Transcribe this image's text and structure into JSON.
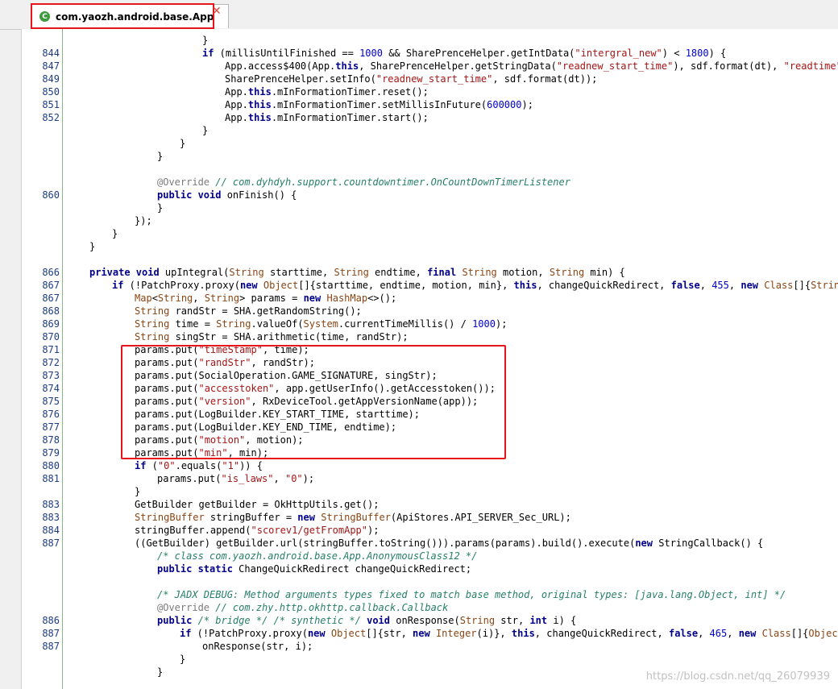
{
  "tab": {
    "title": "com.yaozh.android.base.App",
    "icon": "class-icon-c",
    "close_icon": "close-icon"
  },
  "lines": [
    {
      "n": "",
      "i": 6,
      "s": [
        [
          "p",
          "}"
        ]
      ]
    },
    {
      "n": "844",
      "i": 6,
      "s": [
        [
          "k",
          "if"
        ],
        [
          "p",
          " (millisUntilFinished == "
        ],
        [
          "n",
          "1000"
        ],
        [
          "p",
          " && SharePrenceHelper.getIntData("
        ],
        [
          "s",
          "\"intergral_new\""
        ],
        [
          "p",
          ") < "
        ],
        [
          "n",
          "1800"
        ],
        [
          "p",
          ") {"
        ]
      ]
    },
    {
      "n": "847",
      "i": 7,
      "s": [
        [
          "p",
          "App.access$400(App."
        ],
        [
          "k",
          "this"
        ],
        [
          "p",
          ", SharePrenceHelper.getStringData("
        ],
        [
          "s",
          "\"readnew_start_time\""
        ],
        [
          "p",
          "), sdf.format(dt), "
        ],
        [
          "s",
          "\"readtime\""
        ],
        [
          "p",
          ", \""
        ]
      ]
    },
    {
      "n": "849",
      "i": 7,
      "s": [
        [
          "p",
          "SharePrenceHelper.setInfo("
        ],
        [
          "s",
          "\"readnew_start_time\""
        ],
        [
          "p",
          ", sdf.format(dt));"
        ]
      ]
    },
    {
      "n": "850",
      "i": 7,
      "s": [
        [
          "p",
          "App."
        ],
        [
          "k",
          "this"
        ],
        [
          "p",
          ".mInFormationTimer.reset();"
        ]
      ]
    },
    {
      "n": "851",
      "i": 7,
      "s": [
        [
          "p",
          "App."
        ],
        [
          "k",
          "this"
        ],
        [
          "p",
          ".mInFormationTimer.setMillisInFuture("
        ],
        [
          "n",
          "600000"
        ],
        [
          "p",
          ");"
        ]
      ]
    },
    {
      "n": "852",
      "i": 7,
      "s": [
        [
          "p",
          "App."
        ],
        [
          "k",
          "this"
        ],
        [
          "p",
          ".mInFormationTimer.start();"
        ]
      ]
    },
    {
      "n": "",
      "i": 6,
      "s": [
        [
          "p",
          "}"
        ]
      ]
    },
    {
      "n": "",
      "i": 5,
      "s": [
        [
          "p",
          "}"
        ]
      ]
    },
    {
      "n": "",
      "i": 4,
      "s": [
        [
          "p",
          "}"
        ]
      ]
    },
    {
      "n": "",
      "i": 0,
      "s": []
    },
    {
      "n": "",
      "i": 4,
      "s": [
        [
          "a",
          "@Override"
        ],
        [
          "c",
          " // com.dyhdyh.support.countdowntimer.OnCountDownTimerListener"
        ]
      ]
    },
    {
      "n": "860",
      "i": 4,
      "s": [
        [
          "k",
          "public void"
        ],
        [
          "p",
          " onFinish() {"
        ]
      ]
    },
    {
      "n": "",
      "i": 4,
      "s": [
        [
          "p",
          "}"
        ]
      ]
    },
    {
      "n": "",
      "i": 3,
      "s": [
        [
          "p",
          "});"
        ]
      ]
    },
    {
      "n": "",
      "i": 2,
      "s": [
        [
          "p",
          "}"
        ]
      ]
    },
    {
      "n": "",
      "i": 1,
      "s": [
        [
          "p",
          "}"
        ]
      ]
    },
    {
      "n": "",
      "i": 0,
      "s": []
    },
    {
      "n": "866",
      "i": 1,
      "s": [
        [
          "k",
          "private void"
        ],
        [
          "p",
          " upIntegral("
        ],
        [
          "t",
          "String"
        ],
        [
          "p",
          " starttime, "
        ],
        [
          "t",
          "String"
        ],
        [
          "p",
          " endtime, "
        ],
        [
          "k",
          "final"
        ],
        [
          "p",
          " "
        ],
        [
          "t",
          "String"
        ],
        [
          "p",
          " motion, "
        ],
        [
          "t",
          "String"
        ],
        [
          "p",
          " min) {"
        ]
      ]
    },
    {
      "n": "867",
      "i": 2,
      "s": [
        [
          "k",
          "if"
        ],
        [
          "p",
          " (!PatchProxy.proxy("
        ],
        [
          "k",
          "new"
        ],
        [
          "p",
          " "
        ],
        [
          "t",
          "Object"
        ],
        [
          "p",
          "[]{starttime, endtime, motion, min}, "
        ],
        [
          "k",
          "this"
        ],
        [
          "p",
          ", changeQuickRedirect, "
        ],
        [
          "k",
          "false"
        ],
        [
          "p",
          ", "
        ],
        [
          "n",
          "455"
        ],
        [
          "p",
          ", "
        ],
        [
          "k",
          "new"
        ],
        [
          "p",
          " "
        ],
        [
          "t",
          "Class"
        ],
        [
          "p",
          "[]{"
        ],
        [
          "t",
          "String"
        ],
        [
          "p",
          ".cl"
        ]
      ]
    },
    {
      "n": "867",
      "i": 3,
      "s": [
        [
          "t",
          "Map"
        ],
        [
          "p",
          "<"
        ],
        [
          "t",
          "String"
        ],
        [
          "p",
          ", "
        ],
        [
          "t",
          "String"
        ],
        [
          "p",
          "> params = "
        ],
        [
          "k",
          "new"
        ],
        [
          "p",
          " "
        ],
        [
          "t",
          "HashMap"
        ],
        [
          "p",
          "<>();"
        ]
      ]
    },
    {
      "n": "868",
      "i": 3,
      "s": [
        [
          "t",
          "String"
        ],
        [
          "p",
          " randStr = SHA.getRandomString();"
        ]
      ]
    },
    {
      "n": "869",
      "i": 3,
      "s": [
        [
          "t",
          "String"
        ],
        [
          "p",
          " time = "
        ],
        [
          "t",
          "String"
        ],
        [
          "p",
          ".valueOf("
        ],
        [
          "t",
          "System"
        ],
        [
          "p",
          ".currentTimeMillis() / "
        ],
        [
          "n",
          "1000"
        ],
        [
          "p",
          ");"
        ]
      ]
    },
    {
      "n": "870",
      "i": 3,
      "s": [
        [
          "t",
          "String"
        ],
        [
          "p",
          " singStr = SHA.arithmetic(time, randStr);"
        ]
      ]
    },
    {
      "n": "871",
      "i": 3,
      "s": [
        [
          "p",
          "params.put("
        ],
        [
          "s",
          "\"timeStamp\""
        ],
        [
          "p",
          ", time);"
        ]
      ]
    },
    {
      "n": "872",
      "i": 3,
      "s": [
        [
          "p",
          "params.put("
        ],
        [
          "s",
          "\"randStr\""
        ],
        [
          "p",
          ", randStr);"
        ]
      ]
    },
    {
      "n": "873",
      "i": 3,
      "s": [
        [
          "p",
          "params.put(SocialOperation.GAME_SIGNATURE, singStr);"
        ]
      ]
    },
    {
      "n": "874",
      "i": 3,
      "s": [
        [
          "p",
          "params.put("
        ],
        [
          "s",
          "\"accesstoken\""
        ],
        [
          "p",
          ", app.getUserInfo().getAccesstoken());"
        ]
      ]
    },
    {
      "n": "875",
      "i": 3,
      "s": [
        [
          "p",
          "params.put("
        ],
        [
          "s",
          "\"version\""
        ],
        [
          "p",
          ", RxDeviceTool.getAppVersionName(app));"
        ]
      ]
    },
    {
      "n": "876",
      "i": 3,
      "s": [
        [
          "p",
          "params.put(LogBuilder.KEY_START_TIME, starttime);"
        ]
      ]
    },
    {
      "n": "877",
      "i": 3,
      "s": [
        [
          "p",
          "params.put(LogBuilder.KEY_END_TIME, endtime);"
        ]
      ]
    },
    {
      "n": "878",
      "i": 3,
      "s": [
        [
          "p",
          "params.put("
        ],
        [
          "s",
          "\"motion\""
        ],
        [
          "p",
          ", motion);"
        ]
      ]
    },
    {
      "n": "879",
      "i": 3,
      "s": [
        [
          "p",
          "params.put("
        ],
        [
          "s",
          "\"min\""
        ],
        [
          "p",
          ", min);"
        ]
      ]
    },
    {
      "n": "880",
      "i": 3,
      "s": [
        [
          "k",
          "if"
        ],
        [
          "p",
          " ("
        ],
        [
          "s",
          "\"0\""
        ],
        [
          "p",
          ".equals("
        ],
        [
          "s",
          "\"1\""
        ],
        [
          "p",
          ")) {"
        ]
      ]
    },
    {
      "n": "881",
      "i": 4,
      "s": [
        [
          "p",
          "params.put("
        ],
        [
          "s",
          "\"is_laws\""
        ],
        [
          "p",
          ", "
        ],
        [
          "s",
          "\"0\""
        ],
        [
          "p",
          ");"
        ]
      ]
    },
    {
      "n": "",
      "i": 3,
      "s": [
        [
          "p",
          "}"
        ]
      ]
    },
    {
      "n": "883",
      "i": 3,
      "s": [
        [
          "p",
          "GetBuilder getBuilder = OkHttpUtils.get();"
        ]
      ]
    },
    {
      "n": "883",
      "i": 3,
      "s": [
        [
          "t",
          "StringBuffer"
        ],
        [
          "p",
          " stringBuffer = "
        ],
        [
          "k",
          "new"
        ],
        [
          "p",
          " "
        ],
        [
          "t",
          "StringBuffer"
        ],
        [
          "p",
          "(ApiStores.API_SERVER_Sec_URL);"
        ]
      ]
    },
    {
      "n": "884",
      "i": 3,
      "s": [
        [
          "p",
          "stringBuffer.append("
        ],
        [
          "s",
          "\"scorev1/getFromApp\""
        ],
        [
          "p",
          ");"
        ]
      ]
    },
    {
      "n": "887",
      "i": 3,
      "s": [
        [
          "p",
          "((GetBuilder) getBuilder.url(stringBuffer.toString())).params(params).build().execute("
        ],
        [
          "k",
          "new"
        ],
        [
          "p",
          " StringCallback() {"
        ]
      ]
    },
    {
      "n": "",
      "i": 4,
      "s": [
        [
          "c",
          "/* class com.yaozh.android.base.App.AnonymousClass12 */"
        ]
      ]
    },
    {
      "n": "",
      "i": 4,
      "s": [
        [
          "k",
          "public static"
        ],
        [
          "p",
          " ChangeQuickRedirect changeQuickRedirect;"
        ]
      ]
    },
    {
      "n": "",
      "i": 0,
      "s": []
    },
    {
      "n": "",
      "i": 4,
      "s": [
        [
          "c",
          "/* JADX DEBUG: Method arguments types fixed to match base method, original types: [java.lang.Object, int] */"
        ]
      ]
    },
    {
      "n": "",
      "i": 4,
      "s": [
        [
          "a",
          "@Override"
        ],
        [
          "c",
          " // com.zhy.http.okhttp.callback.Callback"
        ]
      ]
    },
    {
      "n": "886",
      "i": 4,
      "s": [
        [
          "k",
          "public"
        ],
        [
          "c",
          " /* bridge */ /* synthetic */"
        ],
        [
          "p",
          " "
        ],
        [
          "k",
          "void"
        ],
        [
          "p",
          " onResponse("
        ],
        [
          "t",
          "String"
        ],
        [
          "p",
          " str, "
        ],
        [
          "k",
          "int"
        ],
        [
          "p",
          " i) {"
        ]
      ]
    },
    {
      "n": "887",
      "i": 5,
      "s": [
        [
          "k",
          "if"
        ],
        [
          "p",
          " (!PatchProxy.proxy("
        ],
        [
          "k",
          "new"
        ],
        [
          "p",
          " "
        ],
        [
          "t",
          "Object"
        ],
        [
          "p",
          "[]{str, "
        ],
        [
          "k",
          "new"
        ],
        [
          "p",
          " "
        ],
        [
          "t",
          "Integer"
        ],
        [
          "p",
          "(i)}, "
        ],
        [
          "k",
          "this"
        ],
        [
          "p",
          ", changeQuickRedirect, "
        ],
        [
          "k",
          "false"
        ],
        [
          "p",
          ", "
        ],
        [
          "n",
          "465"
        ],
        [
          "p",
          ", "
        ],
        [
          "k",
          "new"
        ],
        [
          "p",
          " "
        ],
        [
          "t",
          "Class"
        ],
        [
          "p",
          "[]{"
        ],
        [
          "t",
          "Object"
        ],
        [
          "p",
          ".cl"
        ]
      ]
    },
    {
      "n": "887",
      "i": 6,
      "s": [
        [
          "p",
          "onResponse(str, i);"
        ]
      ]
    },
    {
      "n": "",
      "i": 5,
      "s": [
        [
          "p",
          "}"
        ]
      ]
    },
    {
      "n": "",
      "i": 4,
      "s": [
        [
          "p",
          "}"
        ]
      ]
    }
  ],
  "watermark": "https://blog.csdn.net/qq_26079939"
}
